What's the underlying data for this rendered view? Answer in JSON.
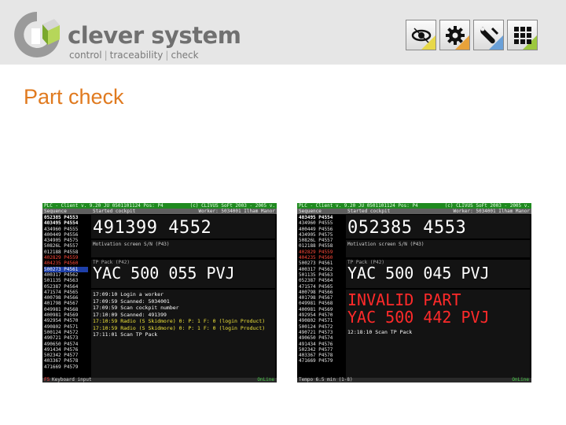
{
  "header": {
    "brand": "clever system",
    "tagline": [
      "control",
      "traceability",
      "check"
    ],
    "toolbar_icons": [
      "eye-icon",
      "gear-icon",
      "wrench-icon",
      "grid-icon"
    ]
  },
  "page_title": "Part check",
  "screens": [
    {
      "titlebar": {
        "left": "PLC - Client v. 9.20 JU 0501101124 Pos: P4",
        "right": "(c) CLIVUS SoFt 2003 - 2005 v."
      },
      "subbar": {
        "left": "Sequence",
        "mid": "Started cockpit",
        "right": "Worker: 5034001 Ilham Manor"
      },
      "sequence": [
        {
          "text": "052385 P4553",
          "style": "bold"
        },
        {
          "text": "403495 P4554",
          "style": "bold"
        },
        {
          "text": "434960 P4555",
          "style": "normal"
        },
        {
          "text": "400449 P4556",
          "style": "normal"
        },
        {
          "text": "434905 P4575",
          "style": "normal"
        },
        {
          "text": "50826L P4557",
          "style": "normal"
        },
        {
          "text": "012188 P4558",
          "style": "normal"
        },
        {
          "text": "402829 P4559",
          "style": "red"
        },
        {
          "text": "404235 P4560",
          "style": "red"
        },
        {
          "text": "500273 P4561",
          "style": "sel"
        },
        {
          "text": "400317 P4562",
          "style": "normal"
        },
        {
          "text": "501135 P4563",
          "style": "normal"
        },
        {
          "text": "052387 P4564",
          "style": "normal"
        },
        {
          "text": "471574 P4565",
          "style": "normal"
        },
        {
          "text": "400798 P4566",
          "style": "normal"
        },
        {
          "text": "401798 P4567",
          "style": "normal"
        },
        {
          "text": "049981 P4568",
          "style": "normal"
        },
        {
          "text": "400981 P4569",
          "style": "normal"
        },
        {
          "text": "492954 P4570",
          "style": "normal"
        },
        {
          "text": "490802 P4571",
          "style": "normal"
        },
        {
          "text": "500124 P4572",
          "style": "normal"
        },
        {
          "text": "490721 P4573",
          "style": "normal"
        },
        {
          "text": "490650 P4574",
          "style": "normal"
        },
        {
          "text": "491434 P4576",
          "style": "normal"
        },
        {
          "text": "502342 P4577",
          "style": "normal"
        },
        {
          "text": "403367 P4578",
          "style": "normal"
        },
        {
          "text": "471669 P4579",
          "style": "normal"
        }
      ],
      "cockpit_label": "Started cockpit",
      "cockpit_number": "491399 4552",
      "motivation": "Motivation screen S/N (P43)",
      "tp_label": "TP Pack (P42)",
      "part_number": "YAC 500 055 PVJ",
      "log": [
        {
          "text": "17:09:10 Login a worker",
          "style": "w"
        },
        {
          "text": "17:09:59 Scanned: 5034001",
          "style": "w"
        },
        {
          "text": "17:09:59 Scan cockpit number",
          "style": "w"
        },
        {
          "text": "17:10:09 Scanned: 491399",
          "style": "w"
        },
        {
          "text": "17:10:59 Radio (S Skidmore) 0: P: 1 F: 0 (login Product)",
          "style": "y"
        },
        {
          "text": "17:10:59 Radio (S Skidmore) 0: P: 1 F: 0 (login Product)",
          "style": "y"
        },
        {
          "text": "17:11:01 Scan TP Pack",
          "style": "w"
        }
      ],
      "bottom": {
        "fkey": "F5",
        "label": "Keyboard input",
        "status": "OnLine"
      }
    },
    {
      "titlebar": {
        "left": "PLC - Client v. 9.20 JU 0501101124 Pos: P4",
        "right": "(c) CLIVUS SoFt 2003 - 2005 v."
      },
      "subbar": {
        "left": "Sequence",
        "mid": "Started cockpit",
        "right": "Worker: 5034001 Ilham Manor"
      },
      "sequence": [
        {
          "text": "403495 P4554",
          "style": "bold"
        },
        {
          "text": "434960 P4555",
          "style": "normal"
        },
        {
          "text": "400449 P4556",
          "style": "normal"
        },
        {
          "text": "434905 P4575",
          "style": "normal"
        },
        {
          "text": "50826L P4557",
          "style": "normal"
        },
        {
          "text": "012188 P4558",
          "style": "normal"
        },
        {
          "text": "402829 P4559",
          "style": "red"
        },
        {
          "text": "404235 P4560",
          "style": "red"
        },
        {
          "text": "500273 P4561",
          "style": "normal"
        },
        {
          "text": "400317 P4562",
          "style": "normal"
        },
        {
          "text": "501135 P4563",
          "style": "normal"
        },
        {
          "text": "052387 P4564",
          "style": "normal"
        },
        {
          "text": "471574 P4565",
          "style": "normal"
        },
        {
          "text": "400798 P4566",
          "style": "normal"
        },
        {
          "text": "401798 P4567",
          "style": "normal"
        },
        {
          "text": "049981 P4568",
          "style": "normal"
        },
        {
          "text": "400981 P4569",
          "style": "normal"
        },
        {
          "text": "492954 P4570",
          "style": "normal"
        },
        {
          "text": "490802 P4571",
          "style": "normal"
        },
        {
          "text": "500124 P4572",
          "style": "normal"
        },
        {
          "text": "490721 P4573",
          "style": "normal"
        },
        {
          "text": "490650 P4574",
          "style": "normal"
        },
        {
          "text": "491434 P4576",
          "style": "normal"
        },
        {
          "text": "502342 P4577",
          "style": "normal"
        },
        {
          "text": "403367 P4578",
          "style": "normal"
        },
        {
          "text": "471669 P4579",
          "style": "normal"
        }
      ],
      "cockpit_label": "Started cockpit",
      "cockpit_number": "052385 4553",
      "motivation": "Motivation screen S/N (P43)",
      "tp_label": "TP Pack (P42)",
      "part_number": "YAC 500 045 PVJ",
      "invalid": [
        "INVALID PART",
        "YAC 500 442 PVJ"
      ],
      "after_line": "12:18:10 Scan TP Pack",
      "bottom": {
        "fkey": "",
        "label": "Tempo 6.5 min (1-8)",
        "status": "OnLine"
      }
    }
  ]
}
